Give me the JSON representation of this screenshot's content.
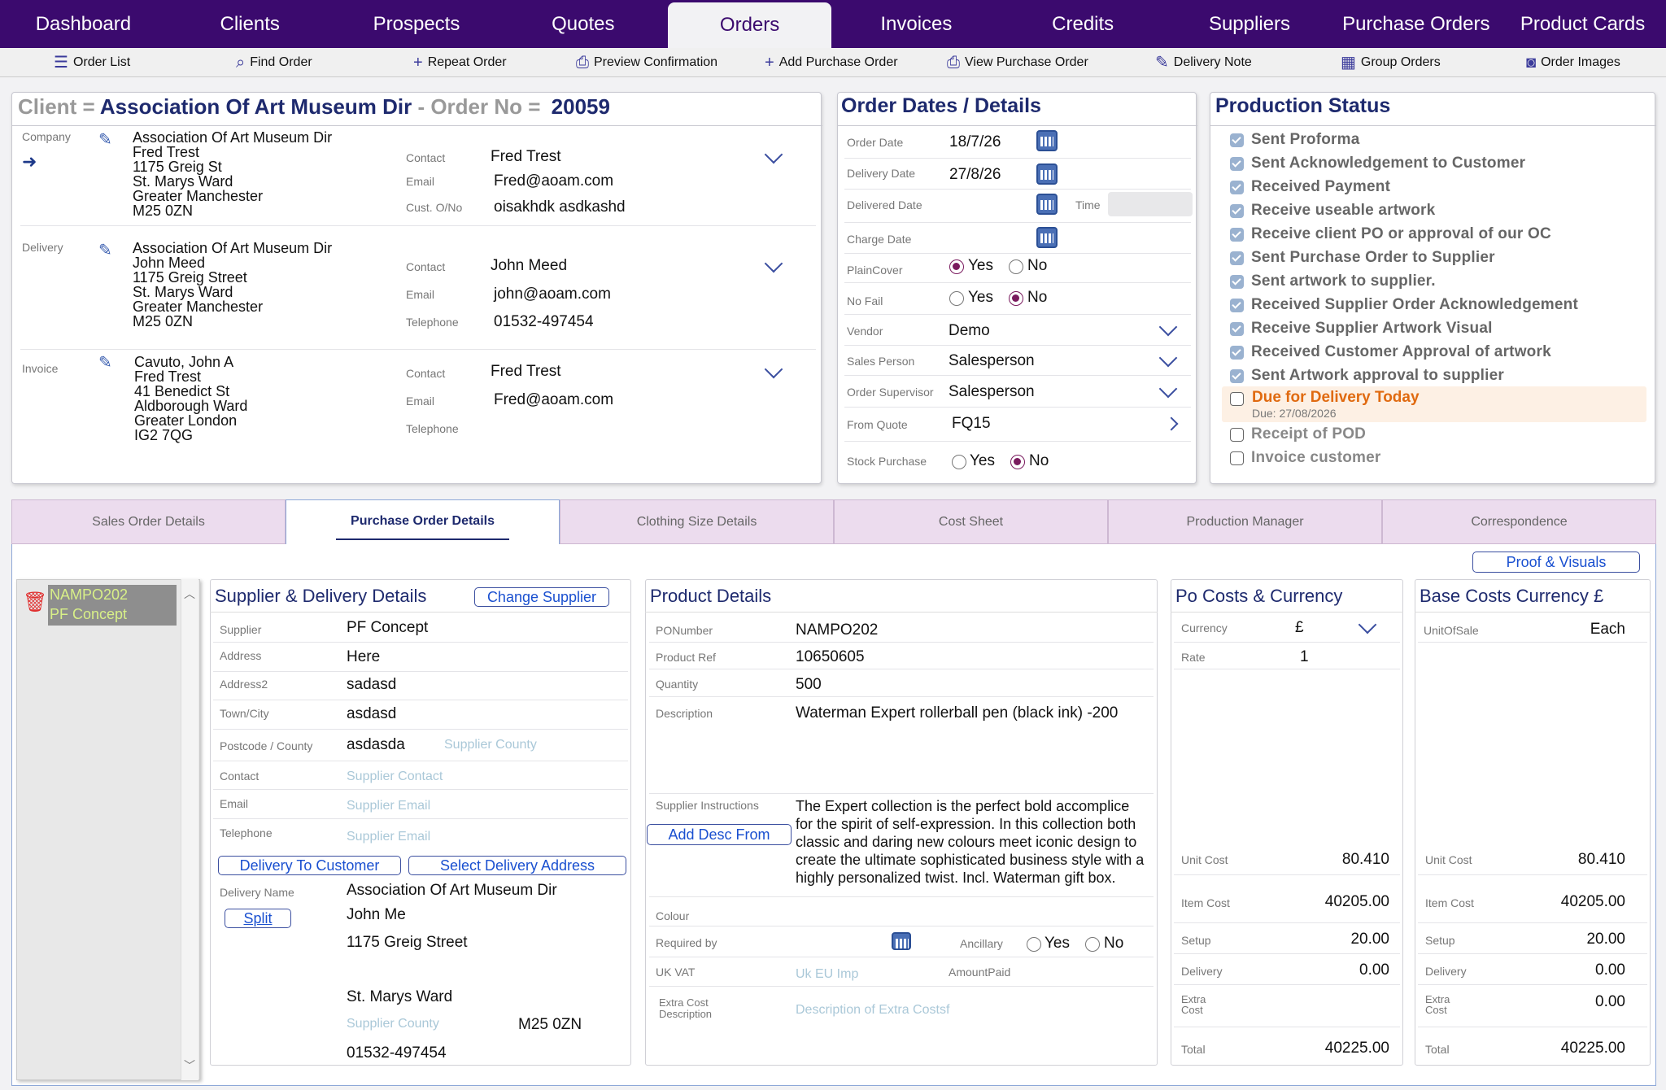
{
  "nav": {
    "tabs": [
      "Dashboard",
      "Clients",
      "Prospects",
      "Quotes",
      "Orders",
      "Invoices",
      "Credits",
      "Suppliers",
      "Purchase Orders",
      "Product Cards"
    ],
    "active": "Orders"
  },
  "toolbar": {
    "order_list": "Order List",
    "find_order": "Find Order",
    "repeat_order": "Repeat Order",
    "preview_confirmation": "Preview Confirmation",
    "add_purchase_order": "Add Purchase Order",
    "view_purchase_order": "View Purchase Order",
    "delivery_note": "Delivery Note",
    "group_orders": "Group Orders",
    "order_images": "Order Images"
  },
  "client_panel": {
    "client_label": "Client =",
    "client_name": "Association Of Art Museum Dir",
    "order_no_label": "- Order No =",
    "order_no": "20059",
    "company": {
      "label": "Company",
      "address": [
        "Association Of Art Museum Dir",
        "Fred Trest",
        "1175 Greig St",
        "St. Marys Ward",
        "Greater Manchester",
        "M25 0ZN"
      ],
      "contact_label": "Contact",
      "contact": "Fred Trest",
      "email_label": "Email",
      "email": "Fred@aoam.com",
      "custono_label": "Cust. O/No",
      "custono": "oisakhdk asdkashd"
    },
    "delivery": {
      "label": "Delivery",
      "address": [
        "Association Of Art Museum Dir",
        "John Meed",
        "1175 Greig Street",
        "St. Marys Ward",
        "Greater Manchester",
        "M25 0ZN"
      ],
      "contact_label": "Contact",
      "contact": "John Meed",
      "email_label": "Email",
      "email": "john@aoam.com",
      "telephone_label": "Telephone",
      "telephone": "01532-497454"
    },
    "invoice": {
      "label": "Invoice",
      "address": [
        "Cavuto, John A",
        "Fred Trest",
        "41 Benedict St",
        "Aldborough Ward",
        "Greater London",
        "IG2 7QG"
      ],
      "contact_label": "Contact",
      "contact": "Fred Trest",
      "email_label": "Email",
      "email": "Fred@aoam.com",
      "telephone_label": "Telephone"
    }
  },
  "dates_panel": {
    "title": "Order Dates / Details",
    "order_date_label": "Order Date",
    "order_date": "18/7/26",
    "delivery_date_label": "Delivery Date",
    "delivery_date": "27/8/26",
    "delivered_date_label": "Delivered Date",
    "time_label": "Time",
    "charge_date_label": "Charge Date",
    "plaincover_label": "PlainCover",
    "plaincover": "Yes",
    "nofail_label": "No Fail",
    "nofail": "No",
    "vendor_label": "Vendor",
    "vendor": "Demo",
    "sales_person_label": "Sales Person",
    "sales_person": "Salesperson",
    "order_supervisor_label": "Order Supervisor",
    "order_supervisor": "Salesperson",
    "from_quote_label": "From Quote",
    "from_quote": "FQ15",
    "stock_purchase_label": "Stock Purchase",
    "stock_purchase": "No",
    "yes": "Yes",
    "no": "No"
  },
  "production_status": {
    "title": "Production Status",
    "items": [
      {
        "label": "Sent Proforma",
        "done": true
      },
      {
        "label": "Sent Acknowledgement to Customer",
        "done": true
      },
      {
        "label": "Received Payment",
        "done": true
      },
      {
        "label": "Receive useable artwork",
        "done": true
      },
      {
        "label": "Receive client PO or approval of our OC",
        "done": true
      },
      {
        "label": "Sent Purchase Order to Supplier",
        "done": true
      },
      {
        "label": "Sent artwork to supplier.",
        "done": true
      },
      {
        "label": "Received Supplier Order Acknowledgement",
        "done": true
      },
      {
        "label": "Receive Supplier Artwork Visual",
        "done": true
      },
      {
        "label": "Received Customer Approval of artwork",
        "done": true
      },
      {
        "label": "Sent Artwork approval to supplier",
        "done": true
      }
    ],
    "due_label": "Due for Delivery Today",
    "due_date": "Due: 27/08/2026",
    "pending": [
      "Receipt of POD",
      "Invoice customer"
    ]
  },
  "tabs": [
    "Sales Order Details",
    "Purchase Order Details",
    "Clothing Size Details",
    "Cost Sheet",
    "Production Manager",
    "Correspondence"
  ],
  "active_tab": "Purchase Order Details",
  "proof_visuals": "Proof & Visuals",
  "po_list": {
    "number": "NAMPO202",
    "supplier": "PF Concept"
  },
  "supplier": {
    "title": "Supplier & Delivery Details",
    "change_supplier": "Change Supplier",
    "supplier_label": "Supplier",
    "supplier": "PF Concept",
    "address_label": "Address",
    "address": "Here",
    "address2_label": "Address2",
    "address2": "sadasd",
    "town_label": "Town/City",
    "town": "asdasd",
    "postcode_label": "Postcode / County",
    "postcode": "asdasda",
    "county_ph": "Supplier County",
    "contact_label": "Contact",
    "contact_ph": "Supplier Contact",
    "email_label": "Email",
    "email_ph": "Supplier Email",
    "telephone_label": "Telephone",
    "telephone_ph": "Supplier Email",
    "delivery_to_customer": "Delivery To Customer",
    "select_delivery_address": "Select Delivery Address",
    "delivery_name_label": "Delivery Name",
    "delivery_name": "Association Of Art Museum Dir",
    "split": "Split",
    "del_line2": "John Me",
    "del_line3": "1175 Greig Street",
    "del_line4": "St. Marys Ward",
    "del_county_ph": "Supplier County",
    "del_postcode": "M25 0ZN",
    "del_phone": "01532-497454"
  },
  "product": {
    "title": "Product Details",
    "ponumber_label": "PONumber",
    "ponumber": "NAMPO202",
    "product_ref_label": "Product Ref",
    "product_ref": "10650605",
    "quantity_label": "Quantity",
    "quantity": "500",
    "description_label": "Description",
    "description": "Waterman Expert rollerball pen (black ink) -200",
    "supplier_instructions_label": "Supplier Instructions",
    "add_desc_from": "Add Desc From",
    "instructions": "The Expert collection is the perfect bold accomplice for the spirit of self-expression. In this collection both classic and daring new colours meet iconic design to create the ultimate sophisticated business style with a highly personalized twist. Incl. Waterman gift box.",
    "colour_label": "Colour",
    "required_by_label": "Required by",
    "ancillary_label": "Ancillary",
    "ancillary": "No",
    "yes": "Yes",
    "no": "No",
    "uk_vat_label": "UK VAT",
    "uk_vat_ph": "Uk EU Imp",
    "amount_paid_label": "AmountPaid",
    "extra_cost_label": "Extra Cost Description",
    "extra_cost_ph": "Description of Extra Costsf"
  },
  "po_costs": {
    "title": "Po Costs & Currency",
    "currency_label": "Currency",
    "currency": "£",
    "rate_label": "Rate",
    "rate": "1",
    "unit_cost_label": "Unit Cost",
    "unit_cost": "80.410",
    "item_cost_label": "Item Cost",
    "item_cost": "40205.00",
    "setup_label": "Setup",
    "setup": "20.00",
    "delivery_label": "Delivery",
    "delivery": "0.00",
    "extra_cost_label": "Extra Cost",
    "total_label": "Total",
    "total": "40225.00"
  },
  "base_costs": {
    "title": "Base Costs Currency £",
    "unit_of_sale_label": "UnitOfSale",
    "unit_of_sale": "Each",
    "unit_cost_label": "Unit Cost",
    "unit_cost": "80.410",
    "item_cost_label": "Item Cost",
    "item_cost": "40205.00",
    "setup_label": "Setup",
    "setup": "20.00",
    "delivery_label": "Delivery",
    "delivery": "0.00",
    "extra_cost_label": "Extra Cost",
    "extra_cost": "0.00",
    "total_label": "Total",
    "total": "40225.00"
  },
  "colors": {
    "nav_bg": "#3b0a6e",
    "title_blue": "#1e2a6e",
    "due_orange": "#e06a10",
    "tab_bg": "#ecdcee"
  }
}
